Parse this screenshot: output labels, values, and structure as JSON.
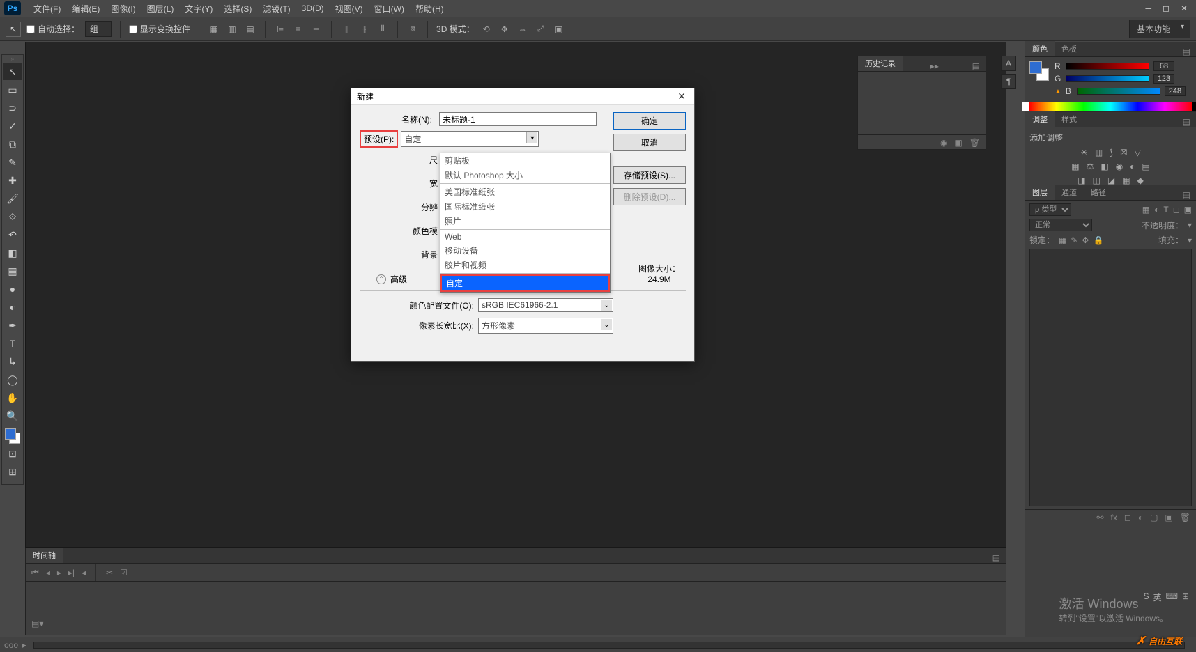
{
  "app": {
    "logo": "Ps"
  },
  "menu": [
    "文件(F)",
    "编辑(E)",
    "图像(I)",
    "图层(L)",
    "文字(Y)",
    "选择(S)",
    "滤镜(T)",
    "3D(D)",
    "视图(V)",
    "窗口(W)",
    "帮助(H)"
  ],
  "options": {
    "autoSelect": "自动选择：",
    "group": "组",
    "showTransform": "显示变换控件",
    "mode3d": "3D 模式：",
    "workspace": "基本功能"
  },
  "panels": {
    "history": "历史记录",
    "color": "颜色",
    "swatches": "色板",
    "adjustments": "调整",
    "styles": "样式",
    "addAdjustment": "添加调整",
    "layers": "图层",
    "channels": "通道",
    "paths": "路径",
    "kind": "ρ 类型",
    "blend": "正常",
    "opacityLabel": "不透明度：",
    "lockLabel": "锁定：",
    "fillLabel": "填充：",
    "timeline": "时间轴"
  },
  "rgb": {
    "r": {
      "label": "R",
      "value": "68"
    },
    "g": {
      "label": "G",
      "value": "123"
    },
    "b": {
      "label": "B",
      "value": "248"
    }
  },
  "dialog": {
    "title": "新建",
    "nameLabel": "名称(N):",
    "nameValue": "未标题-1",
    "presetLabel": "预设(P):",
    "presetValue": "自定",
    "sizeShort": "尺",
    "widthShort": "宽",
    "resShort": "分辨",
    "colorModeShort": "颜色模",
    "bgShort": "背景",
    "advanced": "高级",
    "colorProfileLabel": "颜色配置文件(O):",
    "colorProfileValue": "sRGB IEC61966-2.1",
    "pixelRatioLabel": "像素长宽比(X):",
    "pixelRatioValue": "方形像素",
    "imgSizeLabel": "图像大小：",
    "imgSizeValue": "24.9M",
    "ok": "确定",
    "cancel": "取消",
    "savePreset": "存储预设(S)...",
    "deletePreset": "删除预设(D)..."
  },
  "presetList": [
    {
      "label": "剪贴板"
    },
    {
      "label": "默认 Photoshop 大小"
    },
    {
      "sep": true
    },
    {
      "label": "美国标准纸张"
    },
    {
      "label": "国际标准纸张"
    },
    {
      "label": "照片"
    },
    {
      "sep": true
    },
    {
      "label": "Web"
    },
    {
      "label": "移动设备"
    },
    {
      "label": "胶片和视频"
    },
    {
      "sep": true
    },
    {
      "label": "自定",
      "selected": true,
      "red": true
    }
  ],
  "tools": [
    "↖",
    "▭",
    "◯",
    "⟊",
    "⧉",
    "✎",
    "✐",
    "✍",
    "🖌",
    "⟐",
    "◧",
    "⟊",
    "◐",
    "●",
    "✎",
    "T",
    "↳",
    "◯",
    "✋",
    "🔍"
  ],
  "activate": {
    "line1": "激活 Windows",
    "line2": "转到\"设置\"以激活 Windows。"
  },
  "watermark": "自由互联",
  "status": {
    "zoom": "ooo"
  }
}
